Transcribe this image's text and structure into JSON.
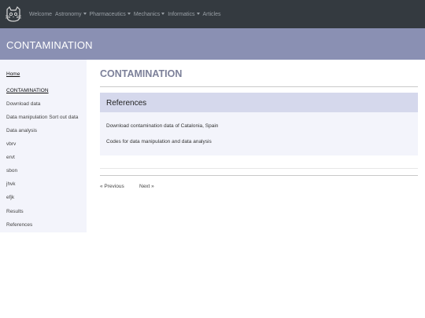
{
  "navbar": {
    "items": [
      {
        "label": "Welcome",
        "dropdown": false
      },
      {
        "label": "Astronomy",
        "dropdown": true
      },
      {
        "label": "Pharmaceutics",
        "dropdown": true
      },
      {
        "label": "Mechanics",
        "dropdown": true
      },
      {
        "label": "Informatics",
        "dropdown": true
      },
      {
        "label": "Articles",
        "dropdown": false
      }
    ],
    "logo_icon": "cat-face-icon",
    "background": "#343a40"
  },
  "banner": {
    "title": "CONTAMINATION",
    "background": "#8a90b3"
  },
  "sidebar": {
    "home": "Home",
    "items": [
      "CONTAMINATION",
      "Download data",
      "Data manipulation Sort out data",
      "Data analysis",
      "vbrv",
      "ervt",
      "sbon",
      "jhvk",
      "efjk",
      "Results",
      "References"
    ]
  },
  "main": {
    "title": "CONTAMINATION",
    "card": {
      "title": "References",
      "items": [
        "Download contamination data of Catalonia, Spain",
        "Codes for data manipulation and data analysis"
      ]
    },
    "pager": {
      "previous": "« Previous",
      "next": "Next »"
    }
  }
}
